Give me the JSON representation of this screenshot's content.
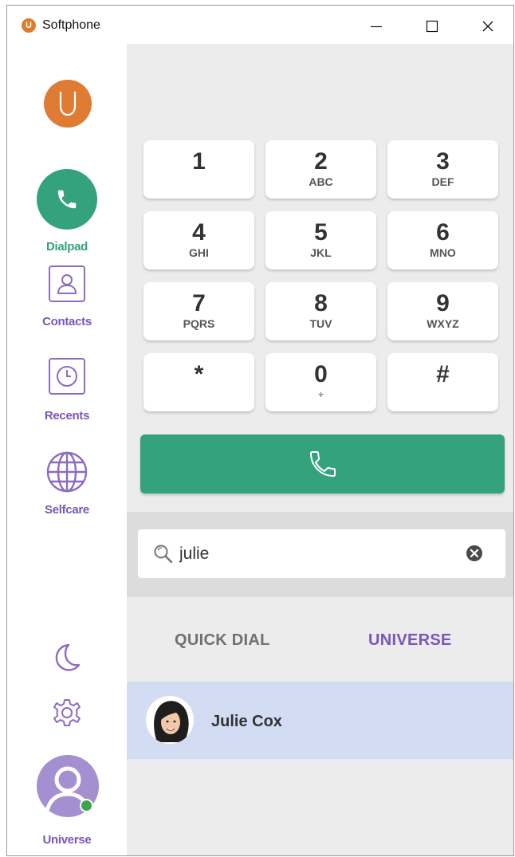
{
  "window": {
    "title": "Softphone",
    "logo_letter": "U"
  },
  "sidebar": {
    "top_avatar_letter": "U",
    "items": [
      {
        "id": "dialpad",
        "label": "Dialpad",
        "icon": "phone-icon",
        "active": true,
        "color": "#34a27c"
      },
      {
        "id": "contacts",
        "label": "Contacts",
        "icon": "contact-card-icon",
        "active": false,
        "color": "#7b55b8"
      },
      {
        "id": "recents",
        "label": "Recents",
        "icon": "clock-icon",
        "active": false,
        "color": "#7b55b8"
      },
      {
        "id": "selfcare",
        "label": "Selfcare",
        "icon": "globe-icon",
        "active": false,
        "color": "#7b55b8"
      }
    ],
    "theme_icon": "moon-icon",
    "settings_icon": "gear-icon",
    "user_label": "Universe",
    "user_status": "online",
    "status_color": "#3fa34a"
  },
  "dialpad": {
    "keys": [
      {
        "digit": "1",
        "letters": ""
      },
      {
        "digit": "2",
        "letters": "ABC"
      },
      {
        "digit": "3",
        "letters": "DEF"
      },
      {
        "digit": "4",
        "letters": "GHI"
      },
      {
        "digit": "5",
        "letters": "JKL"
      },
      {
        "digit": "6",
        "letters": "MNO"
      },
      {
        "digit": "7",
        "letters": "PQRS"
      },
      {
        "digit": "8",
        "letters": "TUV"
      },
      {
        "digit": "9",
        "letters": "WXYZ"
      },
      {
        "digit": "*",
        "letters": ""
      },
      {
        "digit": "0",
        "letters": "+"
      },
      {
        "digit": "#",
        "letters": ""
      }
    ],
    "call_icon": "phone-icon",
    "call_color": "#34a27c"
  },
  "search": {
    "value": "julie",
    "placeholder": ""
  },
  "tabs": [
    {
      "label": "QUICK DIAL",
      "active": false
    },
    {
      "label": "UNIVERSE",
      "active": true
    }
  ],
  "results": [
    {
      "name": "Julie Cox"
    }
  ],
  "colors": {
    "accent_green": "#34a27c",
    "accent_purple": "#7b55b8",
    "avatar_orange": "#e07b34",
    "selected_row": "#d2dcf3"
  }
}
